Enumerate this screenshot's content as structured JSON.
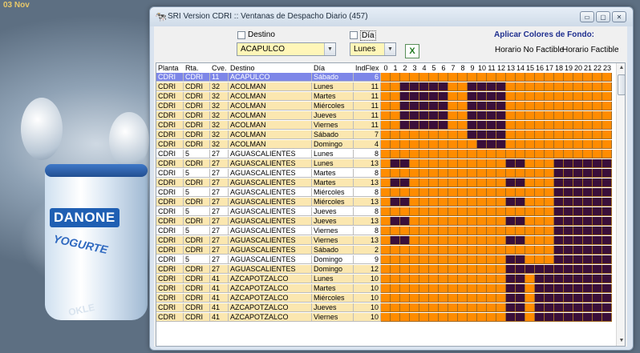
{
  "desktop": {
    "date": "03 Nov",
    "brand": "DANONE",
    "brand_sub": "YOGURTE",
    "back_text": "OKLE"
  },
  "window": {
    "title": "SRI Version CDRI :: Ventanas de Despacho Diario (457)",
    "btn_min": "▭",
    "btn_max": "▢",
    "btn_close": "✕"
  },
  "filters": {
    "destino_label": "Destino",
    "destino_value": "ACAPULCO",
    "dia_label": "Día",
    "dia_value": "Lunes",
    "excel_label": "X",
    "colors_title": "Aplicar Colores de Fondo:",
    "no_factible": "Horario No Factible",
    "factible": "Horario Factible"
  },
  "colors": {
    "slot_on": "#ff8c00",
    "slot_off": "#3a0f3a",
    "row_bg_a": "#fbe7b0",
    "row_bg_b": "#ffffff",
    "row_selected": "#7d86e8"
  },
  "grid": {
    "headers": [
      "Planta",
      "Rta.",
      "Cve.",
      "Destino",
      "Día",
      "IndFlex"
    ],
    "hours": [
      "0",
      "1",
      "2",
      "3",
      "4",
      "5",
      "6",
      "7",
      "8",
      "9",
      "10",
      "11",
      "12",
      "13",
      "14",
      "15",
      "16",
      "17",
      "18",
      "19",
      "20",
      "21",
      "22",
      "23"
    ],
    "rows": [
      {
        "planta": "CDRI",
        "rta": "CDRI",
        "cve": "11",
        "destino": "ACAPULCO",
        "dia": "Sábado",
        "flex": "6",
        "slots": "111111111111111111111111"
      },
      {
        "planta": "CDRI",
        "rta": "CDRI",
        "cve": "32",
        "destino": "ACOLMAN",
        "dia": "Lunes",
        "flex": "11",
        "slots": "110000011000011111111111"
      },
      {
        "planta": "CDRI",
        "rta": "CDRI",
        "cve": "32",
        "destino": "ACOLMAN",
        "dia": "Martes",
        "flex": "11",
        "slots": "110000011000011111111111"
      },
      {
        "planta": "CDRI",
        "rta": "CDRI",
        "cve": "32",
        "destino": "ACOLMAN",
        "dia": "Miércoles",
        "flex": "11",
        "slots": "110000011000011111111111"
      },
      {
        "planta": "CDRI",
        "rta": "CDRI",
        "cve": "32",
        "destino": "ACOLMAN",
        "dia": "Jueves",
        "flex": "11",
        "slots": "110000011000011111111111"
      },
      {
        "planta": "CDRI",
        "rta": "CDRI",
        "cve": "32",
        "destino": "ACOLMAN",
        "dia": "Viernes",
        "flex": "11",
        "slots": "110000011000011111111111"
      },
      {
        "planta": "CDRI",
        "rta": "CDRI",
        "cve": "32",
        "destino": "ACOLMAN",
        "dia": "Sábado",
        "flex": "7",
        "slots": "111111111000011111111111"
      },
      {
        "planta": "CDRI",
        "rta": "CDRI",
        "cve": "32",
        "destino": "ACOLMAN",
        "dia": "Domingo",
        "flex": "4",
        "slots": "111111111100011111111111"
      },
      {
        "planta": "CDRI",
        "rta": "5",
        "cve": "27",
        "destino": "AGUASCALIENTES",
        "dia": "Lunes",
        "flex": "8",
        "slots": "111111111111111111111111"
      },
      {
        "planta": "CDRI",
        "rta": "CDRI",
        "cve": "27",
        "destino": "AGUASCALIENTES",
        "dia": "Lunes",
        "flex": "13",
        "slots": "100111111111100111000000"
      },
      {
        "planta": "CDRI",
        "rta": "5",
        "cve": "27",
        "destino": "AGUASCALIENTES",
        "dia": "Martes",
        "flex": "8",
        "slots": "111111111111111111000000"
      },
      {
        "planta": "CDRI",
        "rta": "CDRI",
        "cve": "27",
        "destino": "AGUASCALIENTES",
        "dia": "Martes",
        "flex": "13",
        "slots": "100111111111100111000000"
      },
      {
        "planta": "CDRI",
        "rta": "5",
        "cve": "27",
        "destino": "AGUASCALIENTES",
        "dia": "Miércoles",
        "flex": "8",
        "slots": "111111111111111111000000"
      },
      {
        "planta": "CDRI",
        "rta": "CDRI",
        "cve": "27",
        "destino": "AGUASCALIENTES",
        "dia": "Miércoles",
        "flex": "13",
        "slots": "100111111111100111000000"
      },
      {
        "planta": "CDRI",
        "rta": "5",
        "cve": "27",
        "destino": "AGUASCALIENTES",
        "dia": "Jueves",
        "flex": "8",
        "slots": "111111111111111111000000"
      },
      {
        "planta": "CDRI",
        "rta": "CDRI",
        "cve": "27",
        "destino": "AGUASCALIENTES",
        "dia": "Jueves",
        "flex": "13",
        "slots": "100111111111100111000000"
      },
      {
        "planta": "CDRI",
        "rta": "5",
        "cve": "27",
        "destino": "AGUASCALIENTES",
        "dia": "Viernes",
        "flex": "8",
        "slots": "111111111111111111000000"
      },
      {
        "planta": "CDRI",
        "rta": "CDRI",
        "cve": "27",
        "destino": "AGUASCALIENTES",
        "dia": "Viernes",
        "flex": "13",
        "slots": "100111111111100111000000"
      },
      {
        "planta": "CDRI",
        "rta": "CDRI",
        "cve": "27",
        "destino": "AGUASCALIENTES",
        "dia": "Sábado",
        "flex": "2",
        "slots": "111111111111111111000000"
      },
      {
        "planta": "CDRI",
        "rta": "5",
        "cve": "27",
        "destino": "AGUASCALIENTES",
        "dia": "Domingo",
        "flex": "9",
        "slots": "111111111111100111000000"
      },
      {
        "planta": "CDRI",
        "rta": "CDRI",
        "cve": "27",
        "destino": "AGUASCALIENTES",
        "dia": "Domingo",
        "flex": "12",
        "slots": "111111111111100000000000"
      },
      {
        "planta": "CDRI",
        "rta": "CDRI",
        "cve": "41",
        "destino": "AZCAPOTZALCO",
        "dia": "Lunes",
        "flex": "10",
        "slots": "111111111111100100000000"
      },
      {
        "planta": "CDRI",
        "rta": "CDRI",
        "cve": "41",
        "destino": "AZCAPOTZALCO",
        "dia": "Martes",
        "flex": "10",
        "slots": "111111111111100100000000"
      },
      {
        "planta": "CDRI",
        "rta": "CDRI",
        "cve": "41",
        "destino": "AZCAPOTZALCO",
        "dia": "Miércoles",
        "flex": "10",
        "slots": "111111111111100100000000"
      },
      {
        "planta": "CDRI",
        "rta": "CDRI",
        "cve": "41",
        "destino": "AZCAPOTZALCO",
        "dia": "Jueves",
        "flex": "10",
        "slots": "111111111111100100000000"
      },
      {
        "planta": "CDRI",
        "rta": "CDRI",
        "cve": "41",
        "destino": "AZCAPOTZALCO",
        "dia": "Viernes",
        "flex": "10",
        "slots": "111111111111100100000000"
      }
    ]
  }
}
